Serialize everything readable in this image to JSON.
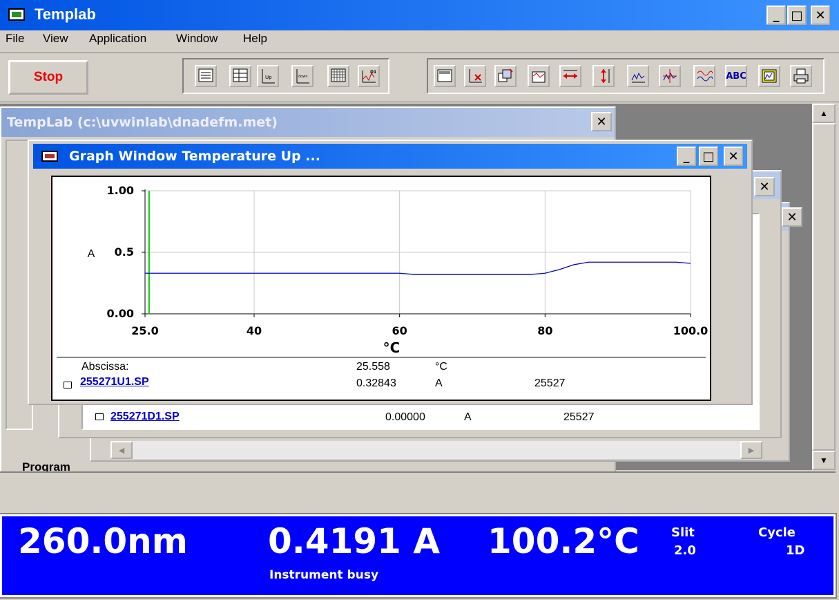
{
  "app": {
    "title": "Templab"
  },
  "menu": [
    "File",
    "View",
    "Application",
    "Window",
    "Help"
  ],
  "toolbar": {
    "stop_label": "Stop",
    "group1_icons": [
      "list-icon",
      "table-icon",
      "temp-up-icon",
      "temp-down-icon",
      "grid-icon",
      "derivative-d1-icon"
    ],
    "group2_icons": [
      "graph-window-icon",
      "delete-trace-icon",
      "copy-window-icon",
      "overlay-icon",
      "expand-horizontal-icon",
      "expand-vertical-icon",
      "peak-icon",
      "cursor-icon",
      "smooth-icon",
      "abc-text-icon",
      "picture-icon",
      "print-icon"
    ]
  },
  "method_window": {
    "title": "TempLab (c:\\uvwinlab\\dnadefm.met)",
    "label_program": "Program"
  },
  "back_window": {
    "file": "255271D1.SP",
    "value": "0.00000",
    "unit": "A",
    "code": "25527"
  },
  "graph_window": {
    "title": "Graph Window Temperature Up ...",
    "abscissa_label": "Abscissa:",
    "abscissa_value": "25.558",
    "abscissa_unit": "°C",
    "file": "255271U1.SP",
    "value": "0.32843",
    "unit": "A",
    "code": "25527"
  },
  "chart_data": {
    "type": "line",
    "xlabel": "°C",
    "ylabel": "A",
    "xlim": [
      25.0,
      100.0
    ],
    "ylim": [
      0.0,
      1.0
    ],
    "x_ticks": [
      "25.0",
      "40",
      "60",
      "80",
      "100.0"
    ],
    "y_ticks": [
      "0.00",
      "0.5",
      "1.00"
    ],
    "grid": true,
    "cursor_x": 25.558,
    "colors": {
      "line": "#0000cc",
      "cursor": "#00cc00"
    },
    "series": [
      {
        "x": [
          25.0,
          30,
          40,
          50,
          55,
          60,
          62,
          65,
          70,
          75,
          78,
          80,
          82,
          84,
          86,
          88,
          90,
          95,
          98,
          100.0
        ],
        "y": [
          0.33,
          0.33,
          0.33,
          0.33,
          0.33,
          0.33,
          0.32,
          0.32,
          0.32,
          0.32,
          0.32,
          0.33,
          0.36,
          0.4,
          0.42,
          0.42,
          0.42,
          0.42,
          0.42,
          0.41
        ]
      }
    ]
  },
  "status": {
    "wavelength": "260.0nm",
    "absorbance": "0.4191 A",
    "temperature": "100.2°C",
    "slit_label": "Slit",
    "slit_value": "2.0",
    "cycle_label": "Cycle",
    "cycle_value": "1D",
    "message": "Instrument busy"
  },
  "colors": {
    "status_bg": "#0000ff",
    "title_active": "#0054e3"
  }
}
